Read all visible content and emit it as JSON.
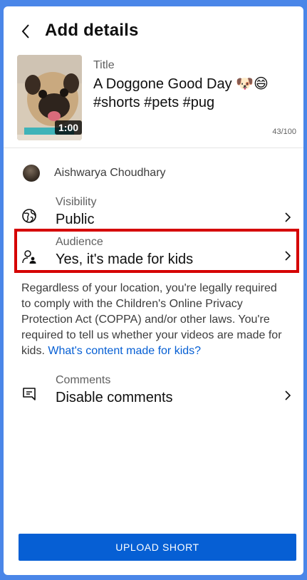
{
  "header": {
    "title": "Add details"
  },
  "video": {
    "duration": "1:00",
    "title_label": "Title",
    "title_value": "A Doggone Good Day 🐶😄 #shorts #pets #pug",
    "char_count": "43/100"
  },
  "channel": {
    "name": "Aishwarya Choudhary"
  },
  "settings": {
    "visibility": {
      "label": "Visibility",
      "value": "Public"
    },
    "audience": {
      "label": "Audience",
      "value": "Yes, it's made for kids"
    },
    "comments": {
      "label": "Comments",
      "value": "Disable comments"
    }
  },
  "notice": {
    "text": "Regardless of your location, you're legally required to comply with the Children's Online Privacy Protection Act (COPPA) and/or other laws. You're required to tell us whether your videos are made for kids. ",
    "link": "What's content made for kids?"
  },
  "footer": {
    "upload_label": "UPLOAD SHORT"
  },
  "colors": {
    "accent": "#065fd4",
    "highlight": "#d50000",
    "frame_background": "#4a86e8"
  },
  "icons": {
    "back": "chevron-left-icon",
    "visibility": "globe-icon",
    "audience": "person-child-icon",
    "comments": "comment-icon",
    "chevron": "chevron-right-icon"
  }
}
